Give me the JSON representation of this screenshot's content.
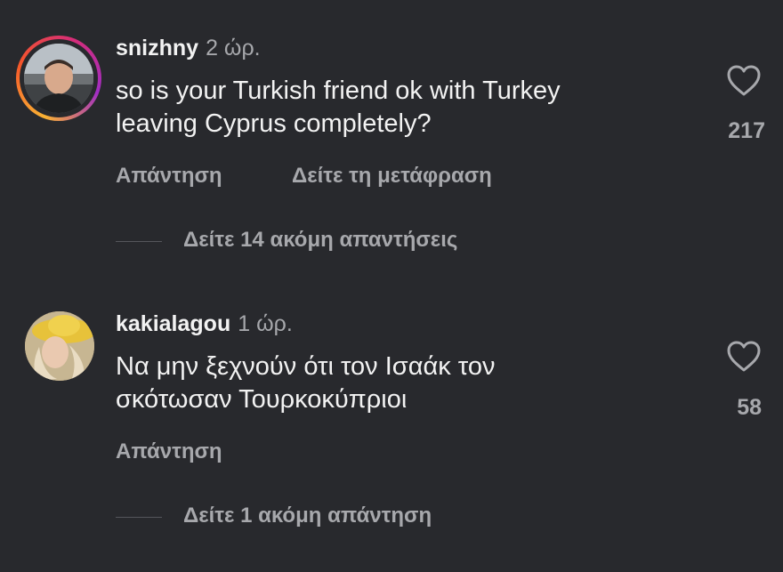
{
  "comments": [
    {
      "username": "snizhny",
      "time": "2 ώρ.",
      "text_line1": "so is your Turkish friend ok with Turkey",
      "text_line2": "leaving Cyprus completely?",
      "likes": "217",
      "reply_label": "Απάντηση",
      "translate_label": "Δείτε τη μετάφραση",
      "more_replies_label": "Δείτε 14 ακόμη απαντήσεις",
      "avatar_icon": "user-photo-avatar",
      "has_story_ring": true
    },
    {
      "username": "kakialagou",
      "time": "1 ώρ.",
      "text_line1": "Να μην ξεχνούν ότι τον Ισαάκ τον",
      "text_line2": "σκότωσαν Τουρκοκύπριοι",
      "likes": "58",
      "reply_label": "Απάντηση",
      "more_replies_label": "Δείτε 1 ακόμη απάντηση",
      "avatar_icon": "user-photo-avatar",
      "has_story_ring": false
    }
  ],
  "colors": {
    "background": "#28292d",
    "primary_text": "#f2f2f2",
    "secondary_text": "#a7a8ac",
    "divider": "#55565b"
  }
}
